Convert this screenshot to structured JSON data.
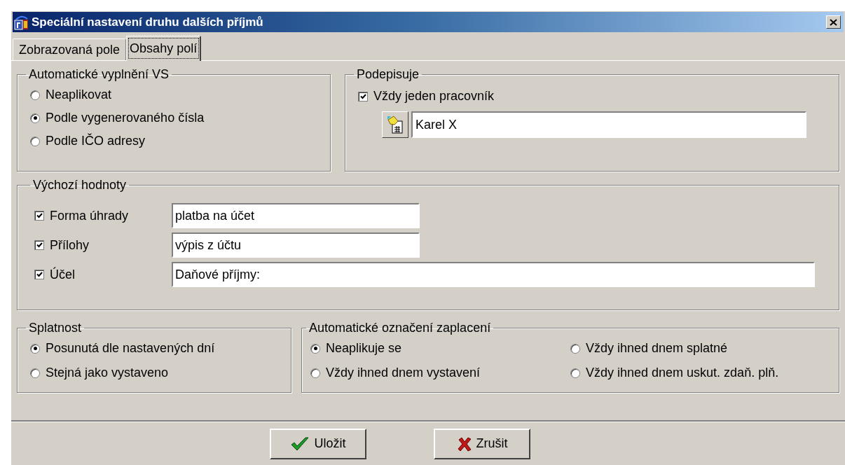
{
  "window": {
    "title": "Speciální nastavení druhu dalších příjmů"
  },
  "tabs": [
    {
      "label": "Zobrazovaná pole",
      "selected": false
    },
    {
      "label": "Obsahy polí",
      "selected": true
    }
  ],
  "vs_group": {
    "title": "Automatické vyplnění VS",
    "options": [
      {
        "label": "Neaplikovat",
        "selected": false
      },
      {
        "label": "Podle vygenerovaného čísla",
        "selected": true
      },
      {
        "label": "Podle IČO adresy",
        "selected": false
      }
    ]
  },
  "signer_group": {
    "title": "Podepisuje",
    "checkbox": {
      "label": "Vždy jeden pracovník",
      "checked": true
    },
    "field": {
      "value": "Karel X"
    }
  },
  "defaults_group": {
    "title": "Výchozí hodnoty",
    "rows": [
      {
        "label": "Forma úhrady",
        "checked": true,
        "value": "platba na účet",
        "kind": "short"
      },
      {
        "label": "Přílohy",
        "checked": true,
        "value": "výpis z účtu",
        "kind": "short"
      },
      {
        "label": "Účel",
        "checked": true,
        "value": "Daňové příjmy:",
        "kind": "long"
      }
    ]
  },
  "due_group": {
    "title": "Splatnost",
    "options": [
      {
        "label": "Posunutá dle nastavených dní",
        "selected": true
      },
      {
        "label": "Stejná jako vystaveno",
        "selected": false
      }
    ]
  },
  "paid_group": {
    "title": "Automatické označení zaplacení",
    "options": [
      {
        "label": "Neaplikuje se",
        "selected": true
      },
      {
        "label": "Vždy ihned dnem splatné",
        "selected": false
      },
      {
        "label": "Vždy ihned dnem vystavení",
        "selected": false
      },
      {
        "label": "Vždy ihned dnem uskut. zdaň. plň.",
        "selected": false
      }
    ]
  },
  "buttons": [
    {
      "label": "Uložit",
      "kind": "save"
    },
    {
      "label": "Zrušit",
      "kind": "cancel"
    }
  ]
}
